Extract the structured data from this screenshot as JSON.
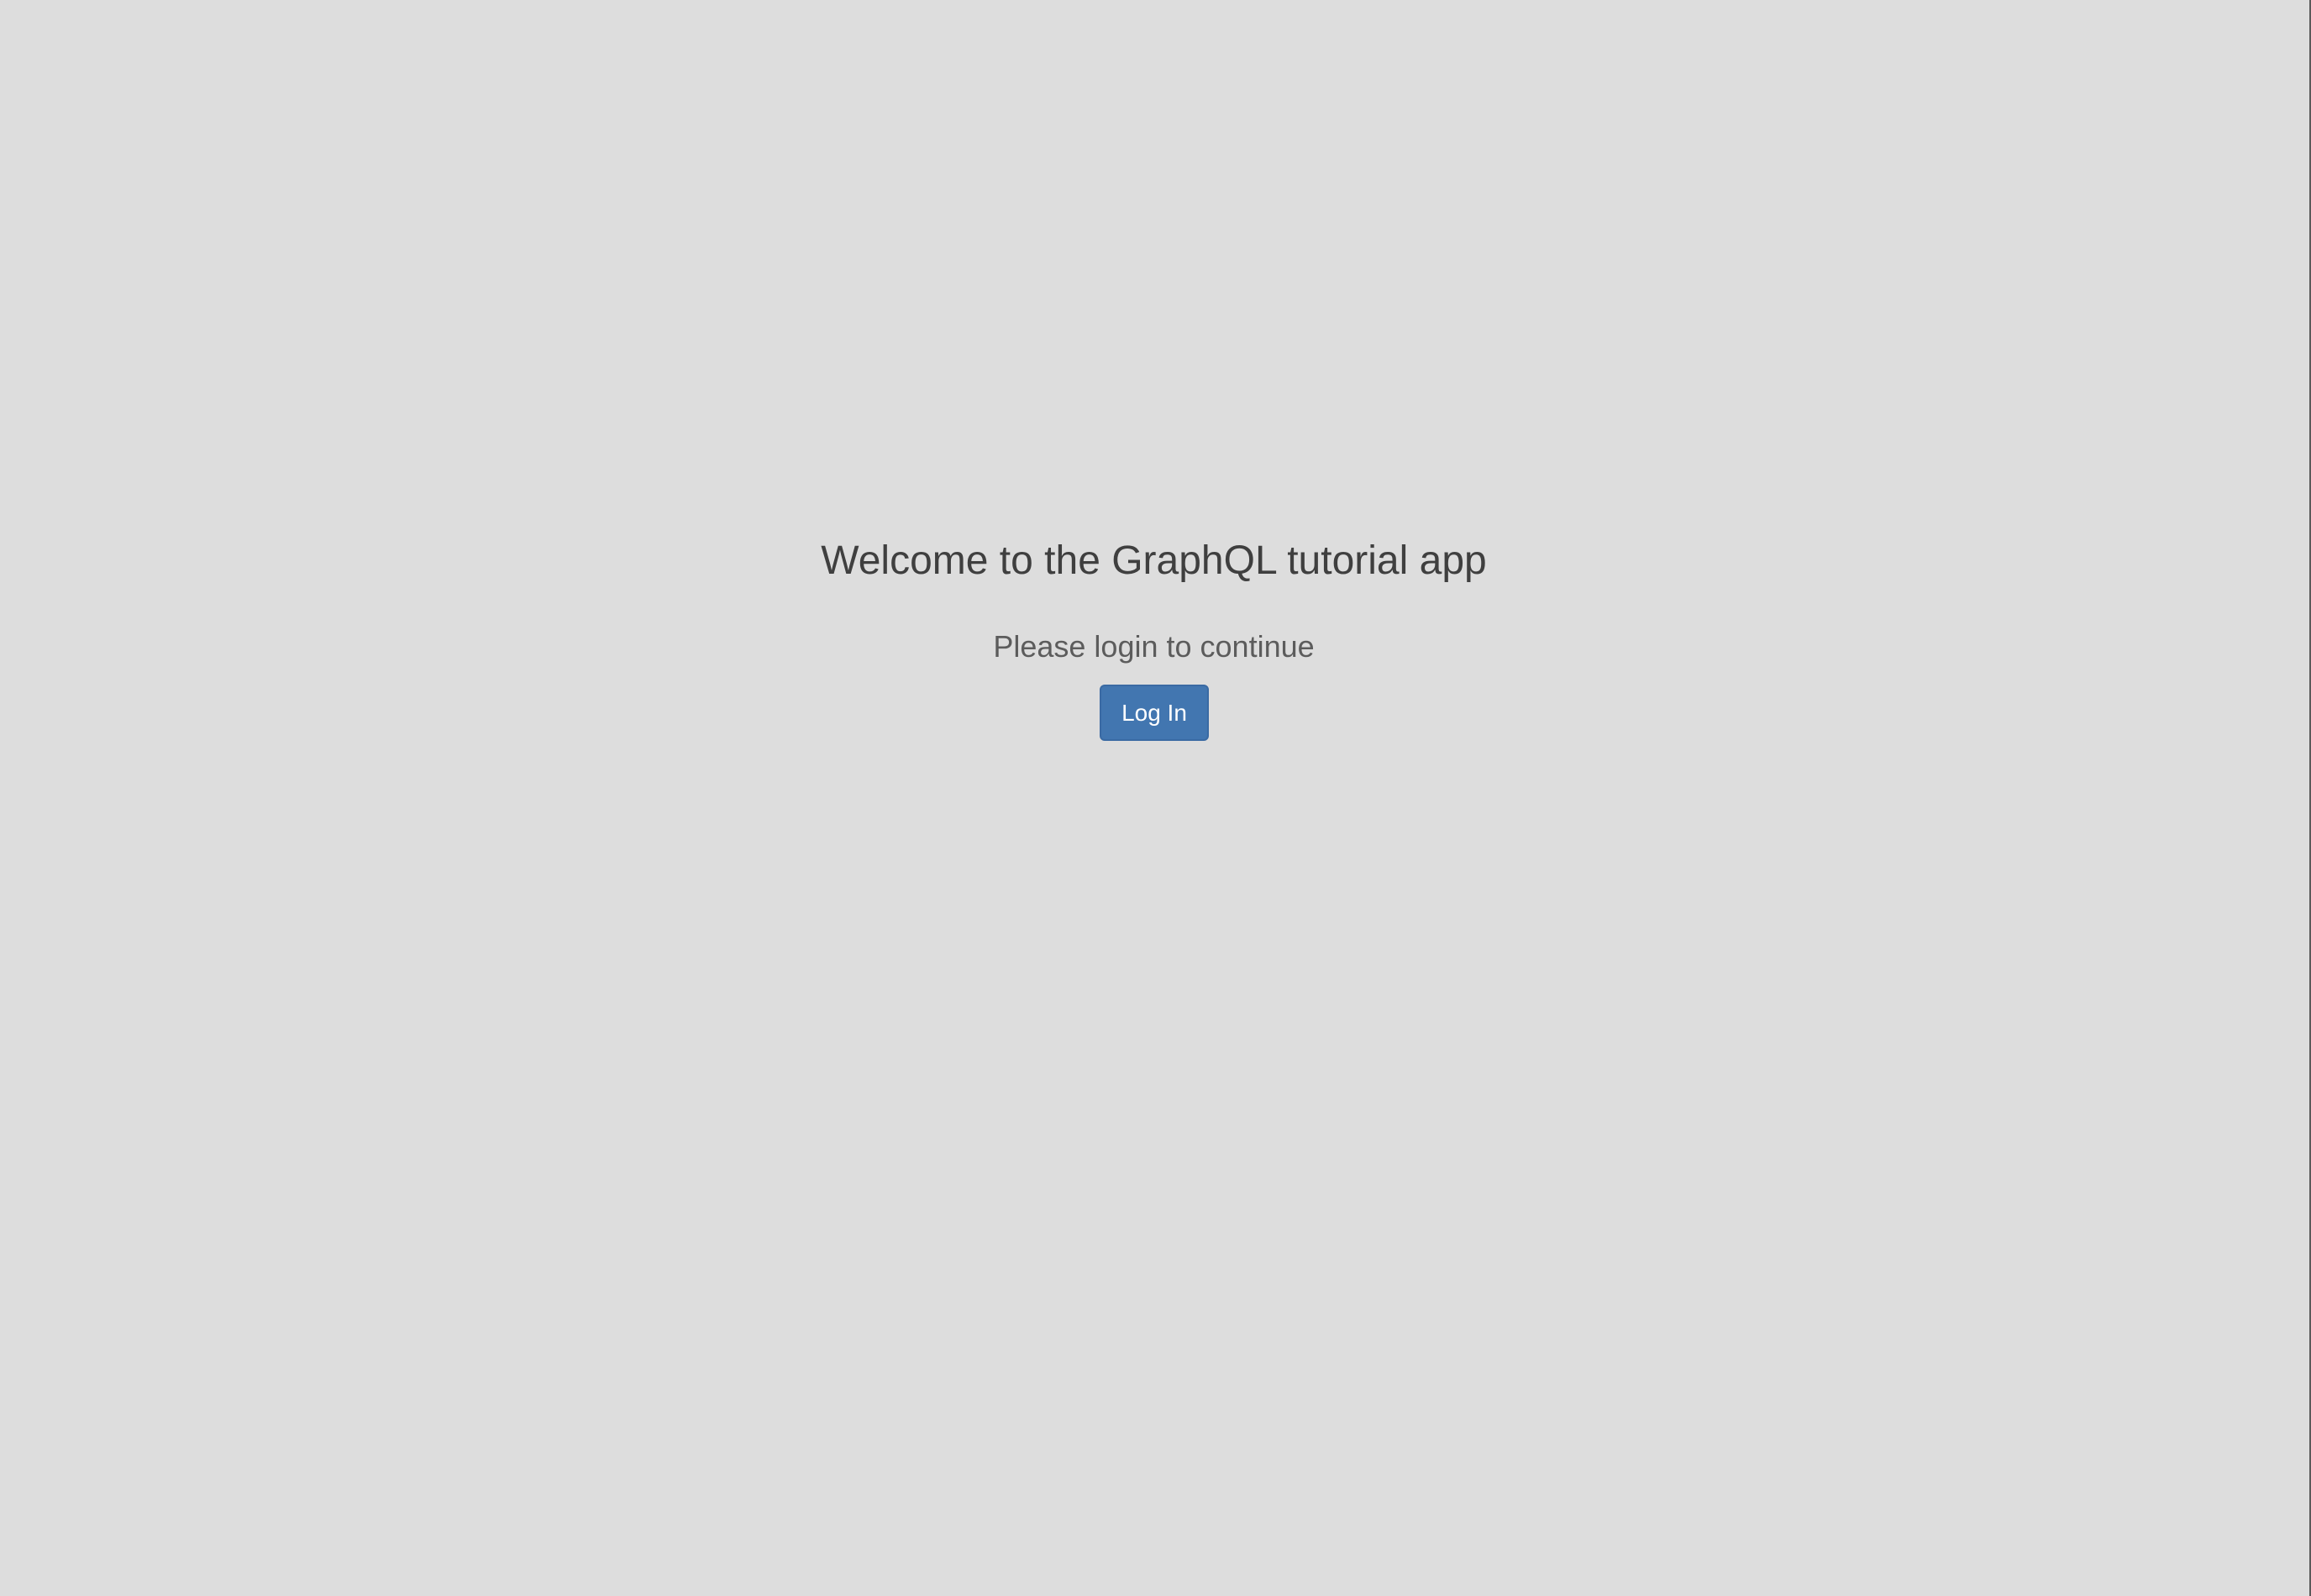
{
  "theme": {
    "background": "#dddddd",
    "title_color": "#3f3f3f",
    "subtitle_color": "#5c5c5c",
    "button_color": "#4276b0",
    "button_text_color": "#ffffff"
  },
  "login": {
    "title": "Welcome to the GraphQL tutorial app",
    "subtitle": "Please login to continue",
    "button_label": "Log In"
  }
}
